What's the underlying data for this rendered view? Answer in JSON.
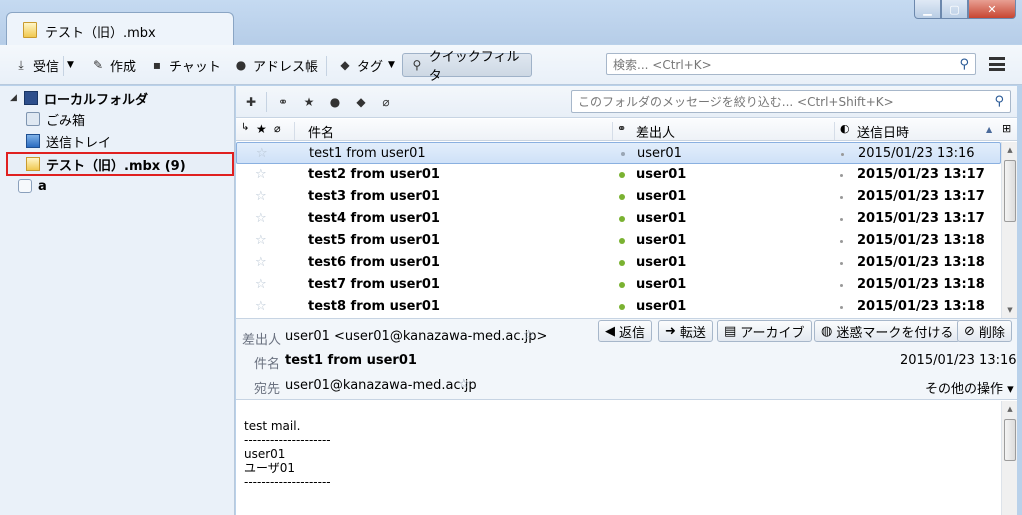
{
  "window": {
    "title": "テスト（旧）.mbx",
    "min_glyph": "▁",
    "max_glyph": "▢",
    "close_glyph": "✕"
  },
  "toolbar": {
    "get_mail": "受信",
    "write": "作成",
    "chat": "チャット",
    "address_book": "アドレス帳",
    "tag": "タグ",
    "quick_filter": "クイックフィルタ",
    "search_placeholder": "検索... <Ctrl+K>"
  },
  "folders": {
    "local": "ローカルフォルダ",
    "trash": "ごみ箱",
    "outbox": "送信トレイ",
    "selected": "テスト（旧）.mbx (9)",
    "other": "a"
  },
  "filter": {
    "placeholder": "このフォルダのメッセージを絞り込む... <Ctrl+Shift+K>"
  },
  "columns": {
    "subject": "件名",
    "sender": "差出人",
    "date": "送信日時"
  },
  "messages": [
    {
      "subject": "test1 from user01",
      "sender": "user01",
      "date": "2015/01/23 13:16",
      "unread": false
    },
    {
      "subject": "test2 from user01",
      "sender": "user01",
      "date": "2015/01/23 13:17",
      "unread": true
    },
    {
      "subject": "test3 from user01",
      "sender": "user01",
      "date": "2015/01/23 13:17",
      "unread": true
    },
    {
      "subject": "test4 from user01",
      "sender": "user01",
      "date": "2015/01/23 13:17",
      "unread": true
    },
    {
      "subject": "test5 from user01",
      "sender": "user01",
      "date": "2015/01/23 13:18",
      "unread": true
    },
    {
      "subject": "test6 from user01",
      "sender": "user01",
      "date": "2015/01/23 13:18",
      "unread": true
    },
    {
      "subject": "test7 from user01",
      "sender": "user01",
      "date": "2015/01/23 13:18",
      "unread": true
    },
    {
      "subject": "test8 from user01",
      "sender": "user01",
      "date": "2015/01/23 13:18",
      "unread": true
    }
  ],
  "header": {
    "from_label": "差出人",
    "from_value": "user01 <user01@kanazawa-med.ac.jp>",
    "subject_label": "件名",
    "subject_value": "test1 from user01",
    "date_value": "2015/01/23 13:16",
    "to_label": "宛先",
    "to_value": "user01@kanazawa-med.ac.jp",
    "more_actions": "その他の操作 ▾"
  },
  "actions": {
    "reply": "返信",
    "forward": "転送",
    "archive": "アーカイブ",
    "junk": "迷惑マークを付ける",
    "delete": "削除"
  },
  "body": {
    "lines": [
      "test mail.",
      "--------------------",
      "user01",
      "ユーザ01",
      "--------------------"
    ]
  }
}
